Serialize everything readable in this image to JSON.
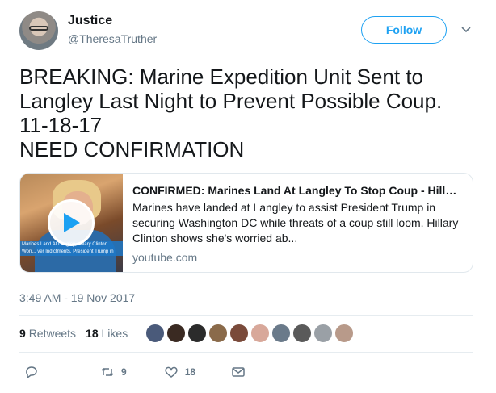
{
  "user": {
    "display_name": "Justice",
    "handle": "@TheresaTruther"
  },
  "follow_label": "Follow",
  "tweet_text": "BREAKING: Marine Expedition Unit Sent to\nLangley Last Night to Prevent Possible Coup.\n11-18-17\nNEED CONFIRMATION",
  "card": {
    "title": "CONFIRMED: Marines Land At Langley To Stop Coup - Hilla...",
    "description": "Marines have landed at Langley to assist President Trump in securing Washington DC while threats of a coup still loom. Hillary Clinton shows she's worried ab...",
    "domain": "youtube.com",
    "thumbnail_caption": "Marines Land At Langley, Hillary Clinton Worr... ver Indictments, President Trump in Waterga..."
  },
  "timestamp": "3:49 AM - 19 Nov 2017",
  "stats": {
    "retweets_count": "9",
    "retweets_label": "Retweets",
    "likes_count": "18",
    "likes_label": "Likes"
  },
  "actions": {
    "retweet_count": "9",
    "like_count": "18"
  },
  "icons": {
    "caret": "chevron-down-icon",
    "play": "play-icon",
    "reply": "reply-icon",
    "retweet": "retweet-icon",
    "like": "heart-icon",
    "message": "envelope-icon"
  },
  "colors": {
    "accent": "#1da1f2",
    "secondary_text": "#657786",
    "border": "#e1e8ed"
  },
  "liker_avatars": [
    "#4a5a7a",
    "#3a2a22",
    "#2b2b2b",
    "#8a6a4a",
    "#7a4a3a",
    "#d8a89a",
    "#6a7a8a",
    "#5a5a5a",
    "#9aa0a6",
    "#b89a8a"
  ]
}
